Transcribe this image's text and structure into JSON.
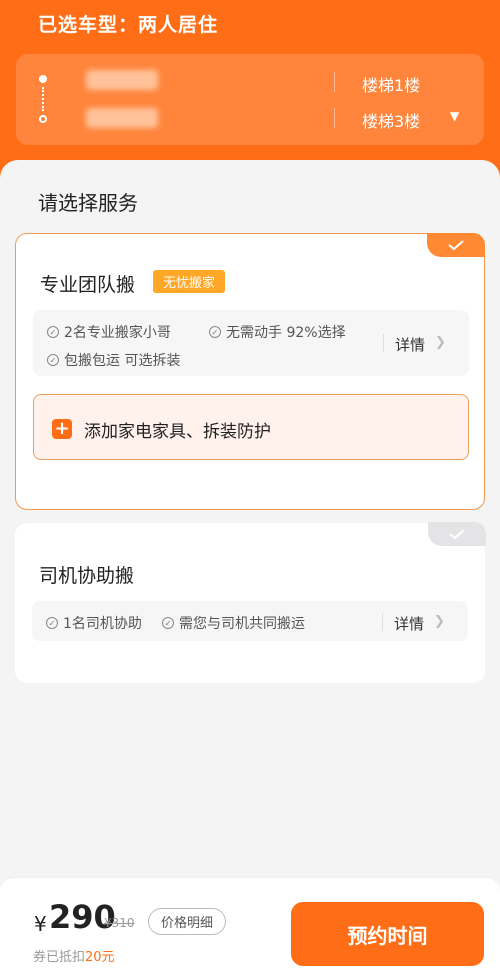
{
  "header": {
    "car_type": "已选车型：两人居住",
    "route": {
      "origin_floor": "楼梯1楼",
      "destination_floor": "楼梯3楼"
    }
  },
  "services": {
    "section_title": "请选择服务",
    "cards": [
      {
        "name": "专业团队搬",
        "tag": "无忧搬家",
        "selected": true,
        "features": [
          "2名专业搬家小哥",
          "无需动手 92%选择",
          "包搬包运 可选拆装"
        ],
        "detail_label": "详情",
        "addon_label": "添加家电家具、拆装防护"
      },
      {
        "name": "司机协助搬",
        "selected": false,
        "features": [
          "1名司机协助",
          "需您与司机共同搬运"
        ],
        "detail_label": "详情"
      }
    ]
  },
  "footer": {
    "currency": "¥",
    "price": "290",
    "original_price": "¥310",
    "breakdown_label": "价格明细",
    "discount_prefix": "券已抵扣",
    "discount_amount": "20元",
    "book_label": "预约时间"
  },
  "colors": {
    "brand": "#ff6e17",
    "tag": "#ffa726"
  }
}
